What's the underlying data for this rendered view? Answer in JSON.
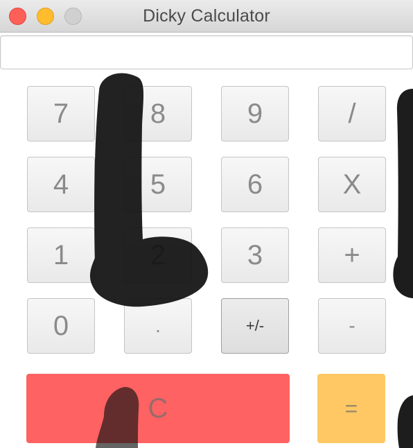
{
  "window": {
    "title": "Dicky Calculator"
  },
  "display": {
    "value": ""
  },
  "keypad": {
    "row1": [
      "7",
      "8",
      "9",
      "/"
    ],
    "row2": [
      "4",
      "5",
      "6",
      "X"
    ],
    "row3": [
      "1",
      "2",
      "3",
      "+"
    ],
    "row4": [
      "0",
      ".",
      "+/-",
      "-"
    ],
    "clear": "C",
    "equals": "="
  },
  "colors": {
    "close": "#fe5f57",
    "minimize": "#febc2e",
    "clear_button": "#fe6262",
    "equals_button": "#ffc864",
    "overlay": "#111111"
  }
}
